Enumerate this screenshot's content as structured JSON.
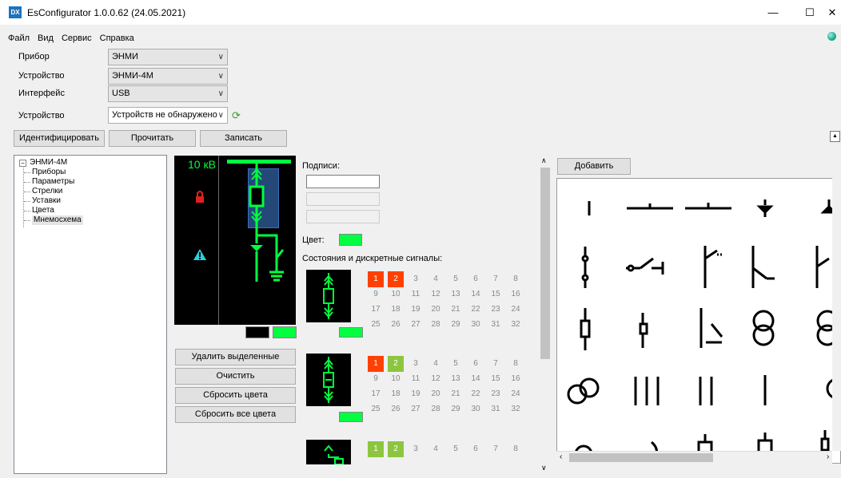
{
  "window": {
    "title": "EsConfigurator 1.0.0.62 (24.05.2021)",
    "app_icon": "DX",
    "minimize": "—",
    "maximize": "☐",
    "close": "✕"
  },
  "menu": [
    "Файл",
    "Вид",
    "Сервис",
    "Справка"
  ],
  "form": {
    "device_label": "Прибор",
    "device_value": "ЭНМИ",
    "unit_label": "Устройство",
    "unit_value": "ЭНМИ-4М",
    "interface_label": "Интерфейс",
    "interface_value": "USB",
    "unit2_label": "Устройство",
    "unit2_value": "Устройств не обнаружено"
  },
  "actions": {
    "identify": "Идентифицировать",
    "read": "Прочитать",
    "write": "Записать"
  },
  "tree": {
    "root": "ЭНМИ-4М",
    "items": [
      "Приборы",
      "Параметры",
      "Стрелки",
      "Уставки",
      "Цвета",
      "Мнемосхема"
    ],
    "selected": "Мнемосхема"
  },
  "preview": {
    "voltage": "10 кВ"
  },
  "editor": {
    "captions_label": "Подписи:",
    "color_label": "Цвет:",
    "states_label": "Состояния и дискретные сигналы:",
    "delete_selected": "Удалить выделенные",
    "clear": "Очистить",
    "reset_colors": "Сбросить цвета",
    "reset_all_colors": "Сбросить все цвета"
  },
  "states": [
    {
      "active": [
        1,
        2
      ],
      "active_color": "#ff4000"
    },
    {
      "active": [
        1
      ],
      "active_color": "#ff4000",
      "secondary": [
        2
      ],
      "secondary_color": "#8cc63f"
    },
    {
      "active": [],
      "secondary": [
        1,
        2
      ],
      "secondary_color": "#8cc63f"
    }
  ],
  "palette": {
    "add_label": "Добавить"
  },
  "colors": {
    "accent_green": "#00ff40",
    "active_orange": "#ff4000",
    "light_green": "#8cc63f"
  }
}
